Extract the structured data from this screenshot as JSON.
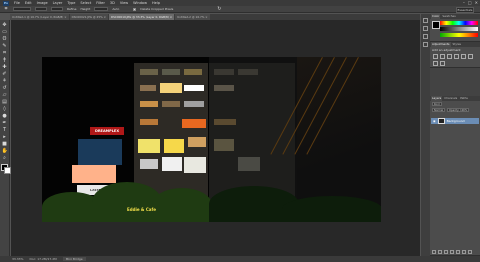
{
  "menubar": {
    "logo": "Ps",
    "items": [
      "File",
      "Edit",
      "Image",
      "Layer",
      "Type",
      "Select",
      "Filter",
      "3D",
      "View",
      "Window",
      "Help"
    ],
    "window_controls": [
      "–",
      "□",
      "✕"
    ]
  },
  "options_bar": {
    "label_refine": "Refine",
    "label_height": "Height",
    "label_auto": "Auto",
    "checkbox_label": "Delete Cropped Pixels",
    "workspace": "Essentials"
  },
  "document_tabs": [
    {
      "label": "Untitled-1 @ 16.7% (Layer 0, RGB/8) ×",
      "active": false
    },
    {
      "label": "DSC00021.JPG @ 25% ×",
      "active": false
    },
    {
      "label": "DSC00019.JPG @ 33.3% (Layer 0, RGB/8) ×",
      "active": true
    },
    {
      "label": "Untitled-2 @ 16.7% ×",
      "active": false
    }
  ],
  "tools": [
    {
      "name": "move",
      "glyph": "✥"
    },
    {
      "name": "marquee",
      "glyph": "▭"
    },
    {
      "name": "lasso",
      "glyph": "ʘ"
    },
    {
      "name": "quick-select",
      "glyph": "✎"
    },
    {
      "name": "crop",
      "glyph": "⌗"
    },
    {
      "name": "eyedropper",
      "glyph": "ǂ"
    },
    {
      "name": "healing",
      "glyph": "✚"
    },
    {
      "name": "brush",
      "glyph": "✐"
    },
    {
      "name": "clone-stamp",
      "glyph": "⚘"
    },
    {
      "name": "history-brush",
      "glyph": "↺"
    },
    {
      "name": "eraser",
      "glyph": "▱"
    },
    {
      "name": "gradient",
      "glyph": "▤"
    },
    {
      "name": "blur",
      "glyph": "◊"
    },
    {
      "name": "dodge",
      "glyph": "●"
    },
    {
      "name": "pen",
      "glyph": "✒"
    },
    {
      "name": "type",
      "glyph": "T"
    },
    {
      "name": "path-select",
      "glyph": "▸"
    },
    {
      "name": "shape",
      "glyph": "■"
    },
    {
      "name": "hand",
      "glyph": "✋"
    },
    {
      "name": "zoom",
      "glyph": "⌕"
    }
  ],
  "canvas": {
    "sign_red_text": "DREAMPLEX",
    "sign_white_text": "LASTFIT",
    "caption_text": "Eddie & Cafe"
  },
  "panels": {
    "color_tabs": [
      "Color",
      "Swatches"
    ],
    "adjust_tabs": [
      "Adjustments",
      "Styles"
    ],
    "adjust_title": "Add an adjustment",
    "layer_tabs": [
      "Layers",
      "Channels",
      "Paths"
    ],
    "layer_kind": "Kind",
    "layer_blend": "Normal",
    "layer_opacity": "Opacity: 100%",
    "layer_name": "Background"
  },
  "statusbar": {
    "zoom": "33.33%",
    "doc_info": "Doc: 17.2M/17.2M",
    "tab": "Mini Bridge"
  },
  "colors": {
    "accent": "#6b8db5",
    "sign_red": "#b01818",
    "caption_yellow": "#f4e14a"
  }
}
